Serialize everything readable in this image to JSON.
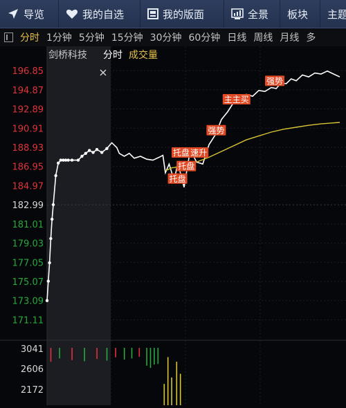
{
  "nav": {
    "items": [
      {
        "label": "导览",
        "icon": "navigation-arrow-icon"
      },
      {
        "label": "我的自选",
        "icon": "heart-icon"
      },
      {
        "label": "我的版面",
        "icon": "layout-icon"
      },
      {
        "label": "全景",
        "icon": "chart-screen-icon"
      },
      {
        "label": "板块",
        "icon": ""
      },
      {
        "label": "主题",
        "icon": ""
      }
    ]
  },
  "periods": {
    "items": [
      "分时",
      "1分钟",
      "5分钟",
      "15分钟",
      "30分钟",
      "60分钟",
      "日线",
      "周线",
      "月线",
      "多"
    ],
    "active_index": 0
  },
  "legend": {
    "stock_name": "剑桥科技",
    "mode": "分时",
    "indicator": "成交量"
  },
  "colors": {
    "up": "#e0333a",
    "down": "#27a93c",
    "flat": "#d8d8d8",
    "avg_line": "#d9c534",
    "price_line": "#ffffff",
    "tag_bg": "#e14a25",
    "accent_active": "#e6c14a"
  },
  "price_axis": {
    "prev_close": 182.99,
    "labels": [
      "196.85",
      "194.87",
      "192.89",
      "190.91",
      "188.93",
      "186.95",
      "184.97",
      "182.99",
      "181.01",
      "179.03",
      "177.05",
      "175.07",
      "173.09",
      "171.11"
    ]
  },
  "volume_axis": {
    "labels": [
      "3041",
      "2606",
      "2172"
    ]
  },
  "chart_data": {
    "type": "line",
    "xlabel": "",
    "ylabel": "",
    "ylim": [
      170.0,
      197.5
    ],
    "series": [
      {
        "name": "",
        "role": "price",
        "x": [
          0,
          1,
          2,
          3,
          4,
          5,
          7,
          9,
          11,
          13,
          15,
          17,
          20,
          25,
          28,
          31,
          34,
          37,
          40,
          44,
          48,
          52,
          56,
          58,
          62,
          66,
          70,
          75,
          80,
          85,
          90,
          93,
          95,
          98,
          102,
          105,
          110,
          115,
          120,
          125,
          130,
          135,
          140,
          145,
          150,
          155,
          160,
          165,
          170,
          175,
          180,
          184,
          188,
          192,
          196,
          200,
          205,
          210,
          215,
          220,
          225,
          230,
          235
        ],
        "values": [
          173.09,
          175.1,
          177.0,
          179.5,
          181.5,
          183.0,
          186.0,
          187.3,
          187.6,
          187.6,
          187.6,
          187.6,
          187.6,
          187.6,
          188.0,
          188.3,
          188.6,
          188.4,
          188.7,
          188.4,
          188.8,
          189.4,
          188.9,
          188.3,
          188.0,
          188.3,
          187.8,
          188.0,
          187.7,
          187.6,
          187.9,
          188.1,
          186.3,
          187.2,
          185.5,
          187.3,
          184.8,
          188.7,
          187.4,
          187.2,
          189.2,
          190.2,
          191.8,
          192.6,
          193.6,
          193.6,
          194.4,
          194.2,
          194.8,
          194.7,
          195.1,
          195.0,
          195.6,
          195.5,
          196.0,
          195.8,
          196.4,
          196.2,
          196.6,
          196.5,
          196.8,
          196.5,
          196.2
        ]
      },
      {
        "name": "",
        "role": "average",
        "x": [
          95,
          100,
          110,
          120,
          130,
          140,
          150,
          160,
          170,
          180,
          190,
          200,
          210,
          220,
          230,
          235
        ],
        "values": [
          186.5,
          186.8,
          187.0,
          187.4,
          187.9,
          188.5,
          189.1,
          189.7,
          190.1,
          190.5,
          190.8,
          191.0,
          191.2,
          191.35,
          191.45,
          191.5
        ]
      }
    ],
    "annotations": [
      {
        "text": "托盘",
        "x": 100,
        "y": 188.0
      },
      {
        "text": "速升",
        "x": 114,
        "y": 188.0
      },
      {
        "text": "托盘",
        "x": 104,
        "y": 186.6
      },
      {
        "text": "托盘",
        "x": 97,
        "y": 185.3
      },
      {
        "text": "强势",
        "x": 128,
        "y": 190.3
      },
      {
        "text": "主主买",
        "x": 141,
        "y": 193.5
      },
      {
        "text": "强势",
        "x": 175,
        "y": 195.4
      }
    ],
    "volume": {
      "ylim": [
        0,
        3100
      ],
      "x": [
        3,
        10,
        20,
        30,
        40,
        48,
        55,
        62,
        68,
        74,
        80,
        83,
        86,
        89,
        94,
        97,
        100,
        104,
        107
      ],
      "values": [
        2900,
        2960,
        2930,
        2910,
        2950,
        2920,
        2980,
        2940,
        2960,
        2990,
        2830,
        2790,
        2850,
        2860,
        1150,
        2600,
        1500,
        2350,
        1700
      ],
      "colors": [
        "#e0333a",
        "#27a93c",
        "#e0333a",
        "#27a93c",
        "#e0333a",
        "#27a93c",
        "#e0333a",
        "#27a93c",
        "#27a93c",
        "#e0333a",
        "#27a93c",
        "#27a93c",
        "#27a93c",
        "#27a93c",
        "#d9c534",
        "#d9c534",
        "#d9c534",
        "#d9c534",
        "#d9c534"
      ]
    },
    "x_range": [
      0,
      240
    ]
  }
}
